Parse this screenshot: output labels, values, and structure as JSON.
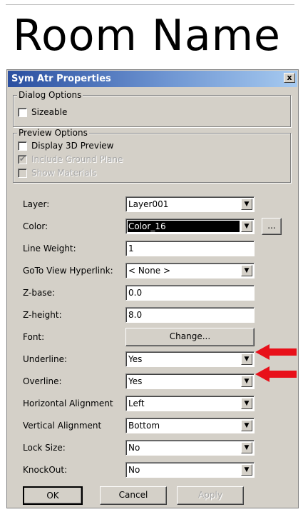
{
  "preview": {
    "text": "Room Name"
  },
  "dialog": {
    "title": "Sym Atr Properties",
    "close_label": "x",
    "dialog_options": {
      "legend": "Dialog Options",
      "sizeable": {
        "label": "Sizeable",
        "checked": false,
        "enabled": true
      }
    },
    "preview_options": {
      "legend": "Preview Options",
      "items": [
        {
          "label": "Display 3D Preview",
          "checked": false,
          "enabled": true
        },
        {
          "label": "Include Ground Plane",
          "checked": true,
          "enabled": false
        },
        {
          "label": "Show Materials",
          "checked": false,
          "enabled": false
        }
      ]
    },
    "properties": [
      {
        "label": "Layer:",
        "value": "Layer001",
        "kind": "dropdown"
      },
      {
        "label": "Color:",
        "value": "Color_16",
        "kind": "dropdown-selected"
      },
      {
        "label": "Line Weight:",
        "value": "1",
        "kind": "text"
      },
      {
        "label": "GoTo View Hyperlink:",
        "value": "< None >",
        "kind": "dropdown"
      },
      {
        "label": "Z-base:",
        "value": "0.0",
        "kind": "text"
      },
      {
        "label": "Z-height:",
        "value": "8.0",
        "kind": "text"
      },
      {
        "label": "Font:",
        "value": "Change...",
        "kind": "button"
      },
      {
        "label": "Underline:",
        "value": "Yes",
        "kind": "dropdown"
      },
      {
        "label": "Overline:",
        "value": "Yes",
        "kind": "dropdown"
      },
      {
        "label": "Horizontal Alignment",
        "value": "Left",
        "kind": "dropdown"
      },
      {
        "label": "Vertical Alignment",
        "value": "Bottom",
        "kind": "dropdown"
      },
      {
        "label": "Lock Size:",
        "value": "No",
        "kind": "dropdown"
      },
      {
        "label": "KnockOut:",
        "value": "No",
        "kind": "dropdown"
      }
    ],
    "color_more_label": "...",
    "buttons": {
      "ok": "OK",
      "cancel": "Cancel",
      "apply": "Apply"
    },
    "arrow_color": "#e8101a"
  }
}
